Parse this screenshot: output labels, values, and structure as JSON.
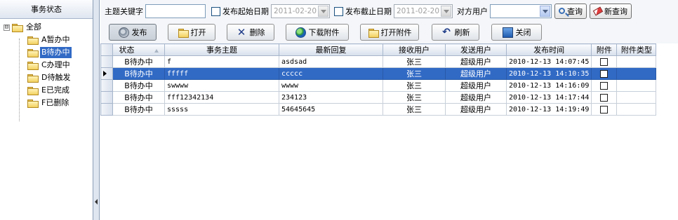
{
  "sidebar": {
    "title": "事务状态",
    "root_label": "全部",
    "root_expander": "⊟",
    "items": [
      {
        "label": "A暂办中"
      },
      {
        "label": "B待办中"
      },
      {
        "label": "C办理中"
      },
      {
        "label": "D待触发"
      },
      {
        "label": "E已完成"
      },
      {
        "label": "F已删除"
      }
    ],
    "selected_index": 1
  },
  "filter": {
    "keyword_label": "主题关键字",
    "keyword_value": "",
    "start_label": "发布起始日期",
    "start_date": "2011-02-20",
    "end_label": "发布截止日期",
    "end_date": "2011-02-20",
    "user_label": "对方用户",
    "user_value": "",
    "query_label": "查询",
    "new_query_label": "新查询"
  },
  "toolbar": {
    "publish": "发布",
    "open": "打开",
    "delete": "删除",
    "download": "下载附件",
    "open_attachment": "打开附件",
    "refresh": "刷新",
    "close": "关闭"
  },
  "table": {
    "columns": [
      "状态",
      "事务主题",
      "最新回复",
      "接收用户",
      "发送用户",
      "发布时间",
      "附件",
      "附件类型"
    ],
    "rows": [
      {
        "status": "B待办中",
        "subject": "f",
        "reply": "asdsad",
        "receiver": "张三",
        "sender": "超级用户",
        "time": "2010-12-13 14:07:45",
        "attachment": false,
        "type": ""
      },
      {
        "status": "B待办中",
        "subject": "fffff",
        "reply": "ccccc",
        "receiver": "张三",
        "sender": "超级用户",
        "time": "2010-12-13 14:10:35",
        "attachment": false,
        "type": ""
      },
      {
        "status": "B待办中",
        "subject": "swwww",
        "reply": "wwww",
        "receiver": "张三",
        "sender": "超级用户",
        "time": "2010-12-13 14:16:09",
        "attachment": false,
        "type": ""
      },
      {
        "status": "B待办中",
        "subject": "fff12342134",
        "reply": "234123",
        "receiver": "张三",
        "sender": "超级用户",
        "time": "2010-12-13 14:17:44",
        "attachment": false,
        "type": ""
      },
      {
        "status": "B待办中",
        "subject": "sssss",
        "reply": "54645645",
        "receiver": "张三",
        "sender": "超级用户",
        "time": "2010-12-13 14:19:49",
        "attachment": false,
        "type": ""
      }
    ],
    "selected_row": 1
  },
  "colors": {
    "selection": "#316ac5",
    "header_gradient_top": "#fbfcfe",
    "header_gradient_bottom": "#d8e0ec"
  },
  "icons": {
    "publish": "disc-icon",
    "open": "folder-icon",
    "delete": "x-icon",
    "download": "globe-icon",
    "open_attachment": "folder-icon",
    "refresh": "refresh-icon",
    "close": "exit-icon",
    "query": "search-icon",
    "new_query": "eraser-icon"
  }
}
